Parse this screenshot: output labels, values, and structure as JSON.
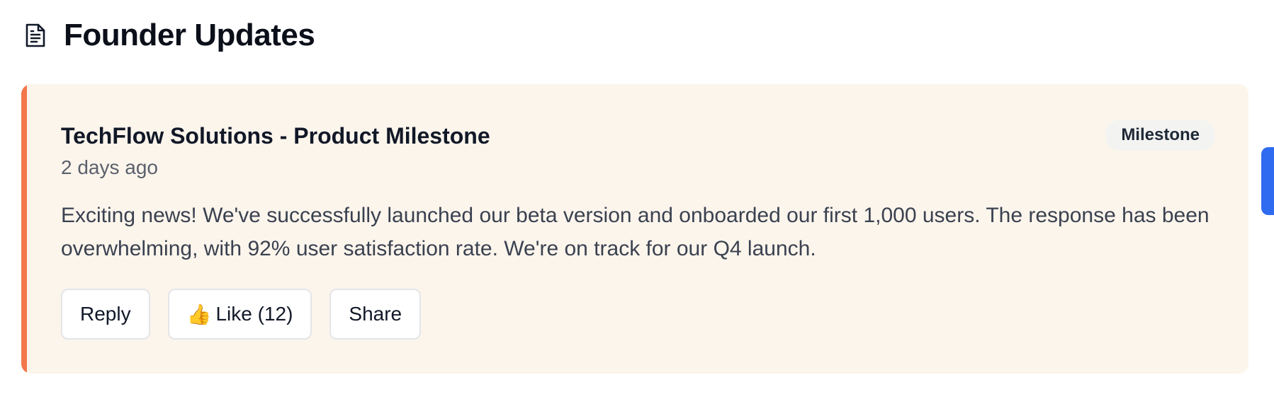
{
  "header": {
    "icon": "document-icon",
    "title": "Founder Updates"
  },
  "update": {
    "accent_color": "#f2784b",
    "title": "TechFlow Solutions - Product Milestone",
    "time": "2 days ago",
    "badge": "Milestone",
    "body": "Exciting news! We've successfully launched our beta version and onboarded our first 1,000 users. The response has been overwhelming, with 92% user satisfaction rate. We're on track for our Q4 launch.",
    "actions": {
      "reply_label": "Reply",
      "like_emoji": "👍",
      "like_label": "Like (12)",
      "share_label": "Share"
    }
  },
  "side_tab": {
    "color": "#2f6bf0"
  }
}
